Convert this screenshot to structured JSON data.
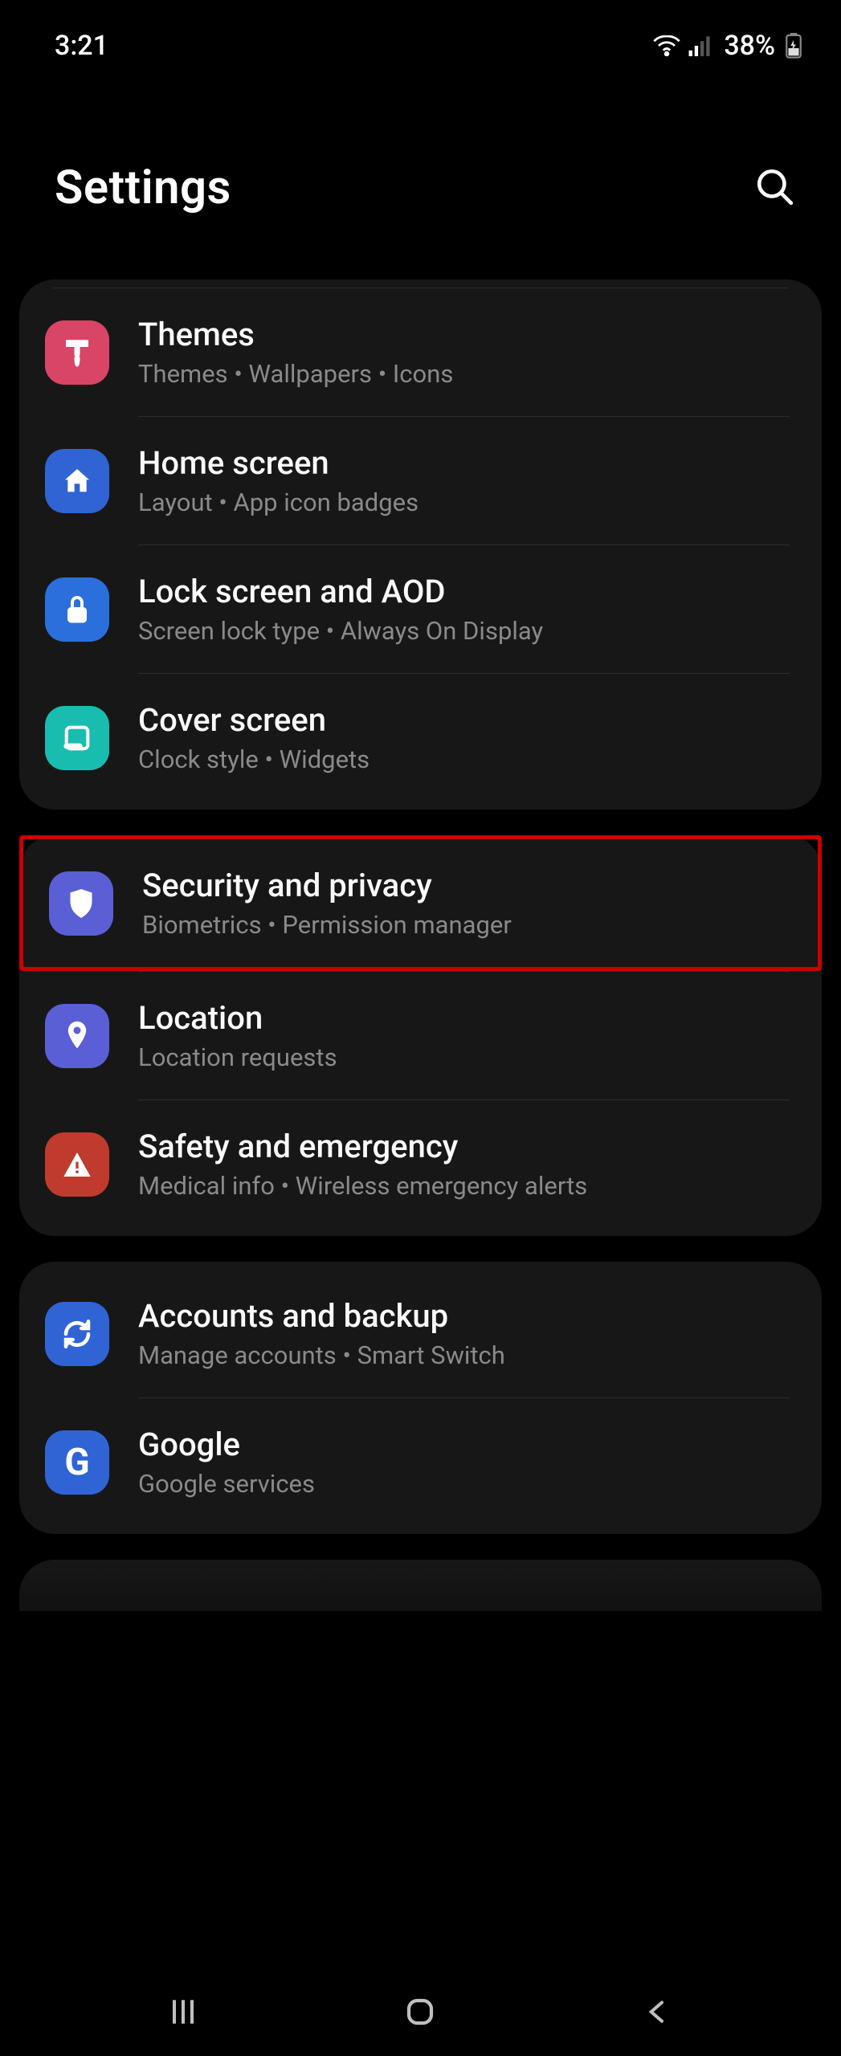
{
  "status": {
    "time": "3:21",
    "battery_pct": "38%"
  },
  "header": {
    "title": "Settings"
  },
  "groups": [
    {
      "top_divider": true,
      "items": [
        {
          "id": "themes",
          "title": "Themes",
          "sub": "Themes  •  Wallpapers  •  Icons",
          "icon": "brush-icon",
          "bg": "#d84566",
          "glyph": "#fff"
        },
        {
          "id": "home-screen",
          "title": "Home screen",
          "sub": "Layout  •  App icon badges",
          "icon": "home-icon",
          "bg": "#3064d4",
          "glyph": "#fff"
        },
        {
          "id": "lock-screen",
          "title": "Lock screen and AOD",
          "sub": "Screen lock type  •  Always On Display",
          "icon": "lock-icon",
          "bg": "#2b6fdc",
          "glyph": "#fff"
        },
        {
          "id": "cover-screen",
          "title": "Cover screen",
          "sub": "Clock style  •  Widgets",
          "icon": "screen-icon",
          "bg": "#19bdb0",
          "glyph": "#fff"
        }
      ]
    },
    {
      "items": [
        {
          "id": "security",
          "title": "Security and privacy",
          "sub": "Biometrics  •  Permission manager",
          "icon": "shield-icon",
          "bg": "#5a5fd6",
          "glyph": "#fff",
          "highlight": true
        },
        {
          "id": "location",
          "title": "Location",
          "sub": "Location requests",
          "icon": "location-icon",
          "bg": "#5a5fd6",
          "glyph": "#fff"
        },
        {
          "id": "safety",
          "title": "Safety and emergency",
          "sub": "Medical info  •  Wireless emergency alerts",
          "icon": "warning-icon",
          "bg": "#c03a2d",
          "glyph": "#fff"
        }
      ]
    },
    {
      "items": [
        {
          "id": "accounts",
          "title": "Accounts and backup",
          "sub": "Manage accounts  •  Smart Switch",
          "icon": "sync-icon",
          "bg": "#3064d4",
          "glyph": "#fff"
        },
        {
          "id": "google",
          "title": "Google",
          "sub": "Google services",
          "icon": "google-icon",
          "bg": "#3064d4",
          "glyph": "#fff"
        }
      ]
    }
  ],
  "icons": {
    "brush-icon": "brush",
    "home-icon": "home",
    "lock-icon": "lock",
    "screen-icon": "screen",
    "shield-icon": "shield",
    "location-icon": "pin",
    "warning-icon": "warn",
    "sync-icon": "sync",
    "google-icon": "g"
  }
}
